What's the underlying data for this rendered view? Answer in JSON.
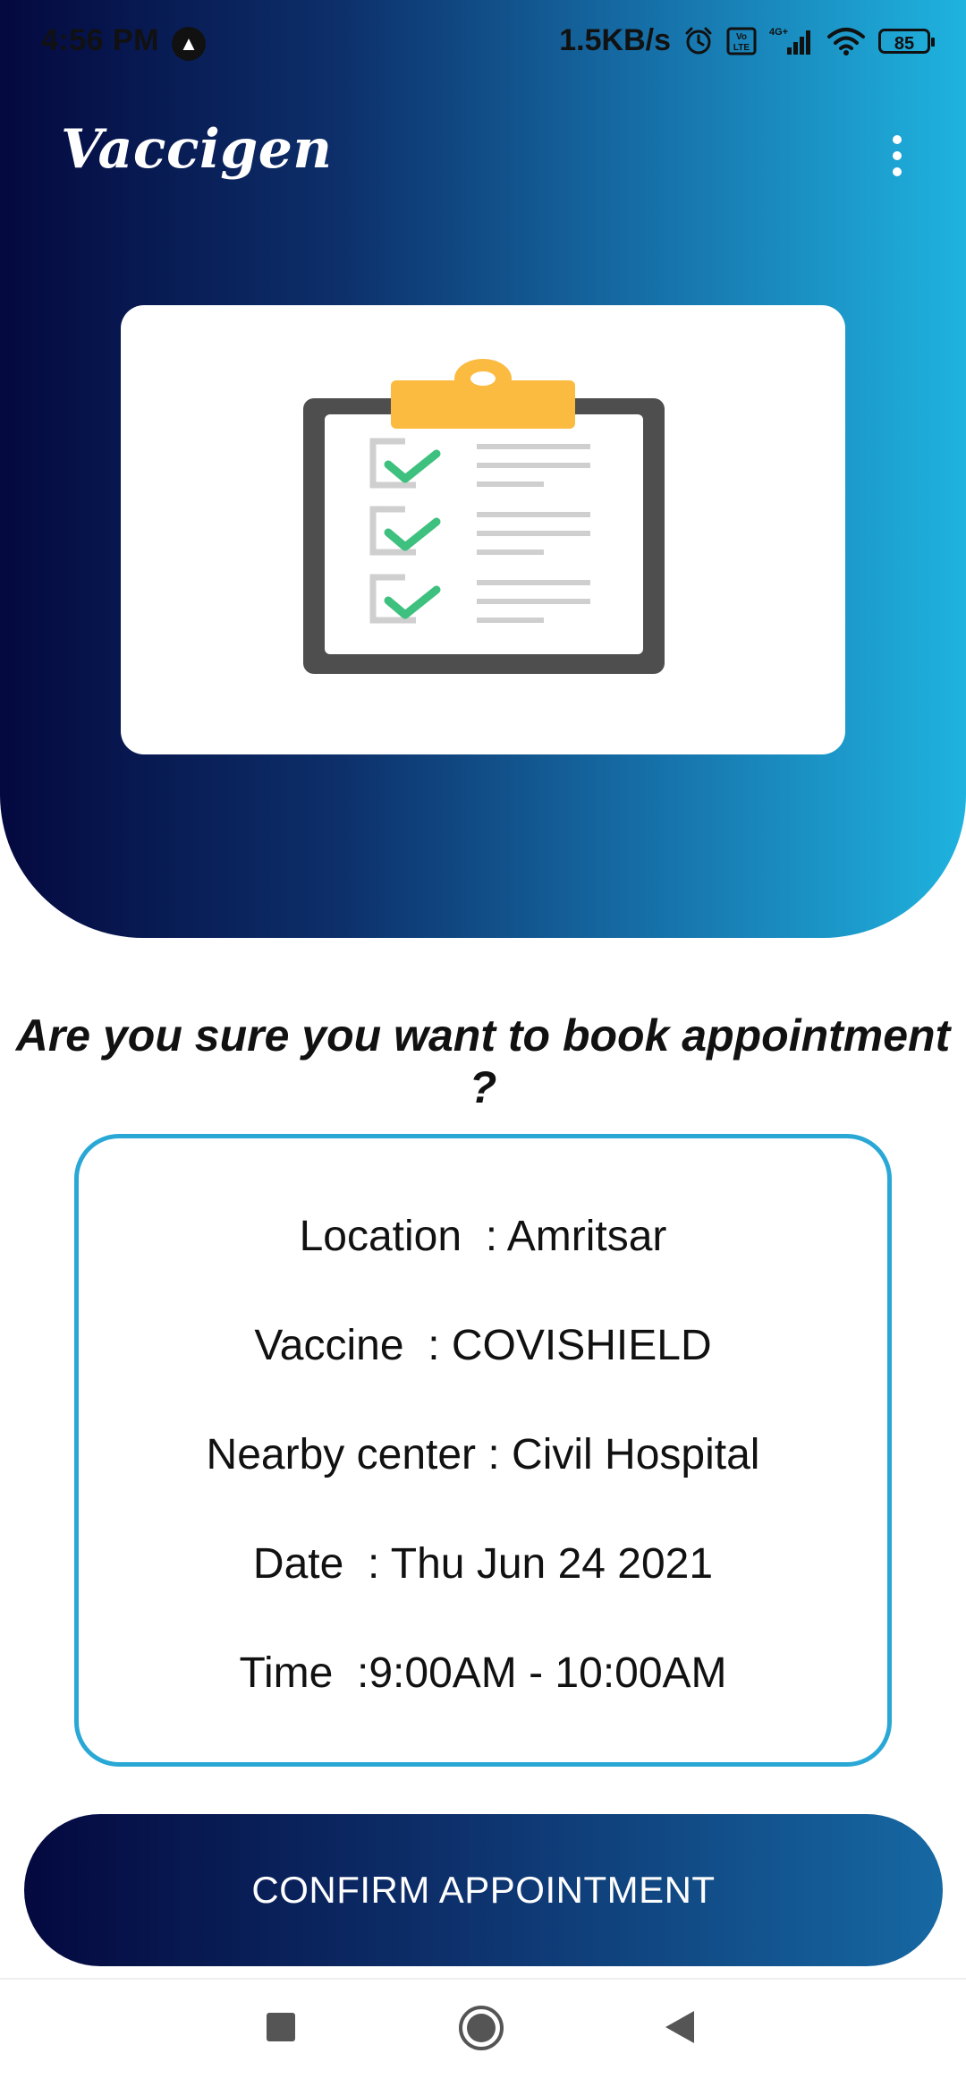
{
  "status_bar": {
    "time": "4:56 PM",
    "network_speed": "1.5KB/s",
    "network_type": "4G+",
    "volte": "Vo LTE",
    "battery": "85",
    "icons": [
      "app-notification-icon",
      "alarm-icon",
      "volte-icon",
      "signal-icon",
      "wifi-icon",
      "battery-icon"
    ]
  },
  "app_bar": {
    "title": "Vaccigen",
    "menu_icon": "more-vert-icon"
  },
  "illustration": {
    "icon": "clipboard-checklist-icon"
  },
  "question": "Are you sure you want to book appointment ?",
  "details": {
    "location": "Location  : Amritsar",
    "vaccine": "Vaccine  : COVISHIELD",
    "center": "Nearby center : Civil Hospital",
    "date": "Date  : Thu Jun 24 2021",
    "time": "Time  :9:00AM - 10:00AM"
  },
  "confirm_button": {
    "label": "CONFIRM APPOINTMENT"
  },
  "nav_bar": {
    "icons": [
      "recents-square-icon",
      "home-circle-icon",
      "back-triangle-icon"
    ]
  },
  "colors": {
    "gradient_start": "#04093f",
    "gradient_end": "#1fb3df",
    "card_border": "#29a8d6",
    "check_green": "#3ec07e",
    "clip_yellow": "#fbbb41"
  }
}
